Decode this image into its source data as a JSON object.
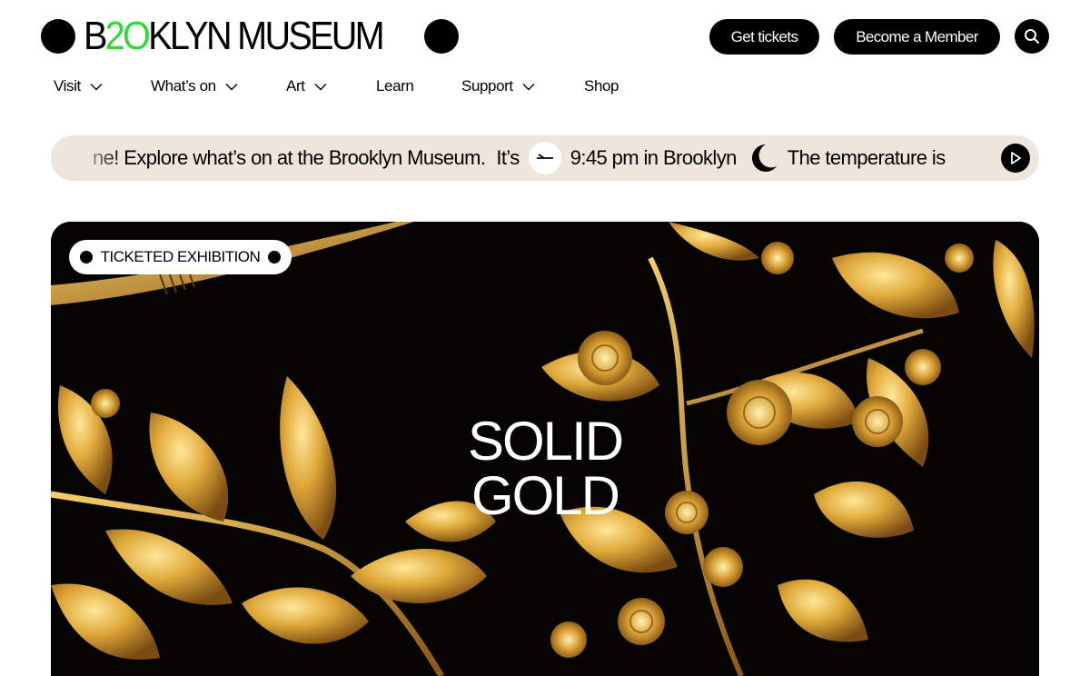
{
  "logo": {
    "part1": "B",
    "part2": "2O",
    "part3": "KLYN MUSEUM",
    "green": "#2fd93a"
  },
  "header": {
    "tickets_label": "Get tickets",
    "member_label": "Become a Member",
    "search_icon": "search-icon"
  },
  "nav": [
    {
      "label": "Visit",
      "dropdown": true
    },
    {
      "label": "What’s on",
      "dropdown": true
    },
    {
      "label": "Art",
      "dropdown": true
    },
    {
      "label": "Learn",
      "dropdown": false
    },
    {
      "label": "Support",
      "dropdown": true
    },
    {
      "label": "Shop",
      "dropdown": false
    }
  ],
  "ticker": {
    "intro": "ne! Explore what’s on at the Brooklyn Museum.",
    "its": "It’s",
    "time": "9:45 pm in Brooklyn",
    "temp": "The temperature is",
    "background": "#eee5dc",
    "play_icon": "play-icon"
  },
  "hero": {
    "badge": "TICKETED EXHIBITION",
    "title_line1": "SOLID",
    "title_line2": "GOLD"
  }
}
